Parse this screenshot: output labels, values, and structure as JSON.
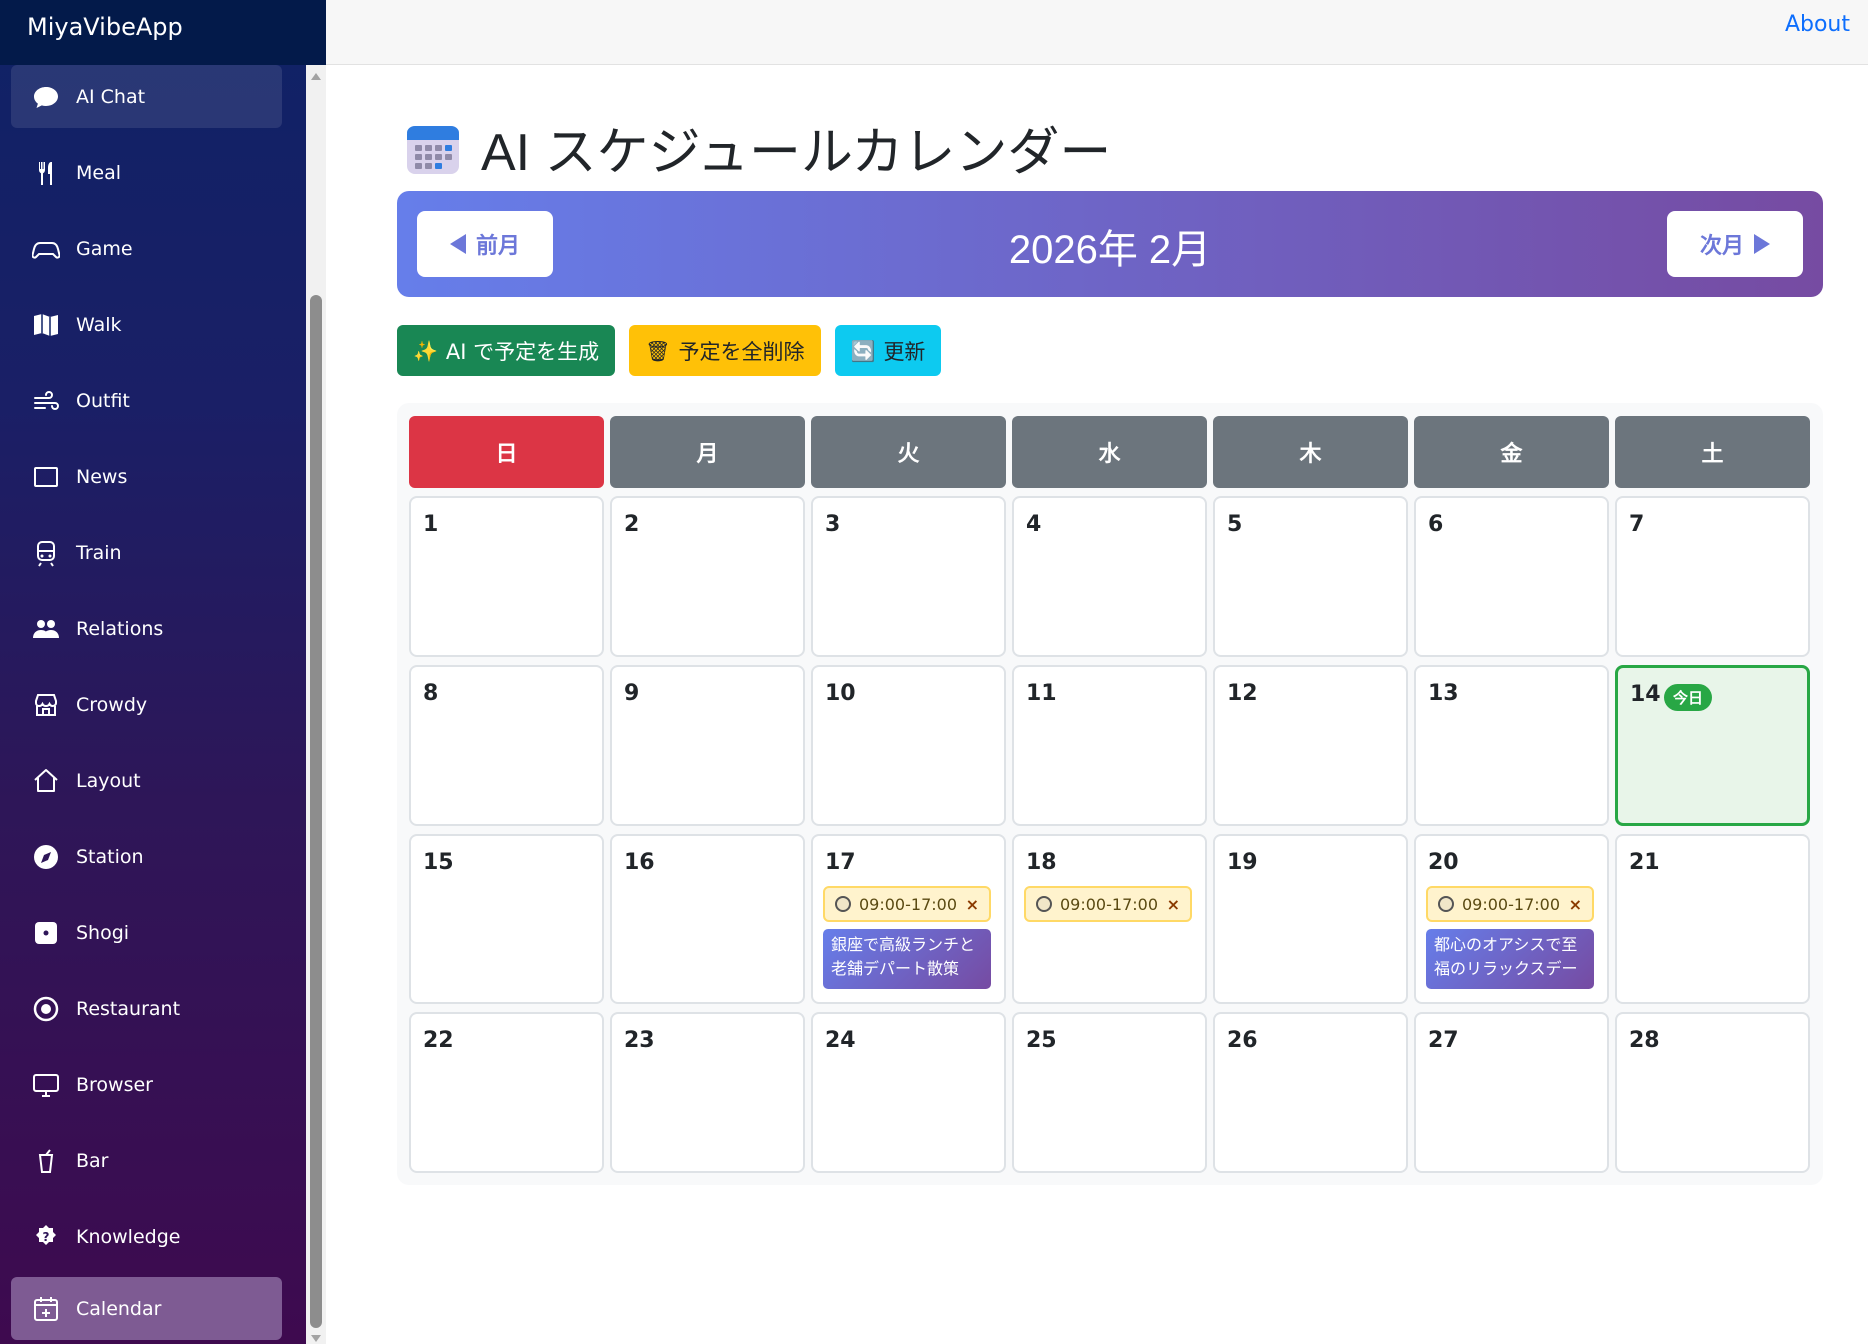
{
  "app": {
    "title": "MiyaVibeApp",
    "about": "About"
  },
  "sidebar": {
    "items": [
      {
        "label": "AI Chat",
        "icon": "chat-bubble-icon",
        "active": true
      },
      {
        "label": "Meal",
        "icon": "fork-knife-icon"
      },
      {
        "label": "Game",
        "icon": "gamepad-icon"
      },
      {
        "label": "Walk",
        "icon": "map-icon"
      },
      {
        "label": "Outfit",
        "icon": "wind-icon"
      },
      {
        "label": "News",
        "icon": "newspaper-icon"
      },
      {
        "label": "Train",
        "icon": "train-icon"
      },
      {
        "label": "Relations",
        "icon": "people-icon"
      },
      {
        "label": "Crowdy",
        "icon": "shop-icon"
      },
      {
        "label": "Layout",
        "icon": "house-icon"
      },
      {
        "label": "Station",
        "icon": "compass-icon"
      },
      {
        "label": "Shogi",
        "icon": "dice-icon"
      },
      {
        "label": "Restaurant",
        "icon": "record-icon"
      },
      {
        "label": "Browser",
        "icon": "monitor-icon"
      },
      {
        "label": "Bar",
        "icon": "cup-icon"
      },
      {
        "label": "Knowledge",
        "icon": "question-badge-icon"
      },
      {
        "label": "Calendar",
        "icon": "calendar-plus-icon",
        "active": true
      }
    ]
  },
  "page": {
    "title": "AI スケジュールカレンダー",
    "month_label": "2026年 2月",
    "prev_label": "前月",
    "next_label": "次月"
  },
  "actions": {
    "generate": {
      "emoji": "✨",
      "label": "AI で予定を生成"
    },
    "delete_all": {
      "emoji": "🗑",
      "label": "予定を全削除"
    },
    "refresh": {
      "emoji": "🔄",
      "label": "更新"
    }
  },
  "calendar": {
    "weekdays": [
      "日",
      "月",
      "火",
      "水",
      "木",
      "金",
      "土"
    ],
    "today_badge": "今日",
    "today": 14,
    "weeks": [
      [
        1,
        2,
        3,
        4,
        5,
        6,
        7
      ],
      [
        8,
        9,
        10,
        11,
        12,
        13,
        14
      ],
      [
        15,
        16,
        17,
        18,
        19,
        20,
        21
      ],
      [
        22,
        23,
        24,
        25,
        26,
        27,
        28
      ]
    ],
    "events": [
      {
        "day": 17,
        "time": "09:00-17:00",
        "title": "銀座で高級ランチと老舗デパート散策"
      },
      {
        "day": 18,
        "time": "09:00-17:00",
        "title": ""
      },
      {
        "day": 20,
        "time": "09:00-17:00",
        "title": "都心のオアシスで至福のリラックスデー"
      }
    ],
    "remove_symbol": "×"
  },
  "colors": {
    "sunday": "#dc3545",
    "weekday": "#6c757d",
    "today_border": "#28a745",
    "accent_gradient_start": "#667eea",
    "accent_gradient_end": "#764ba2"
  }
}
